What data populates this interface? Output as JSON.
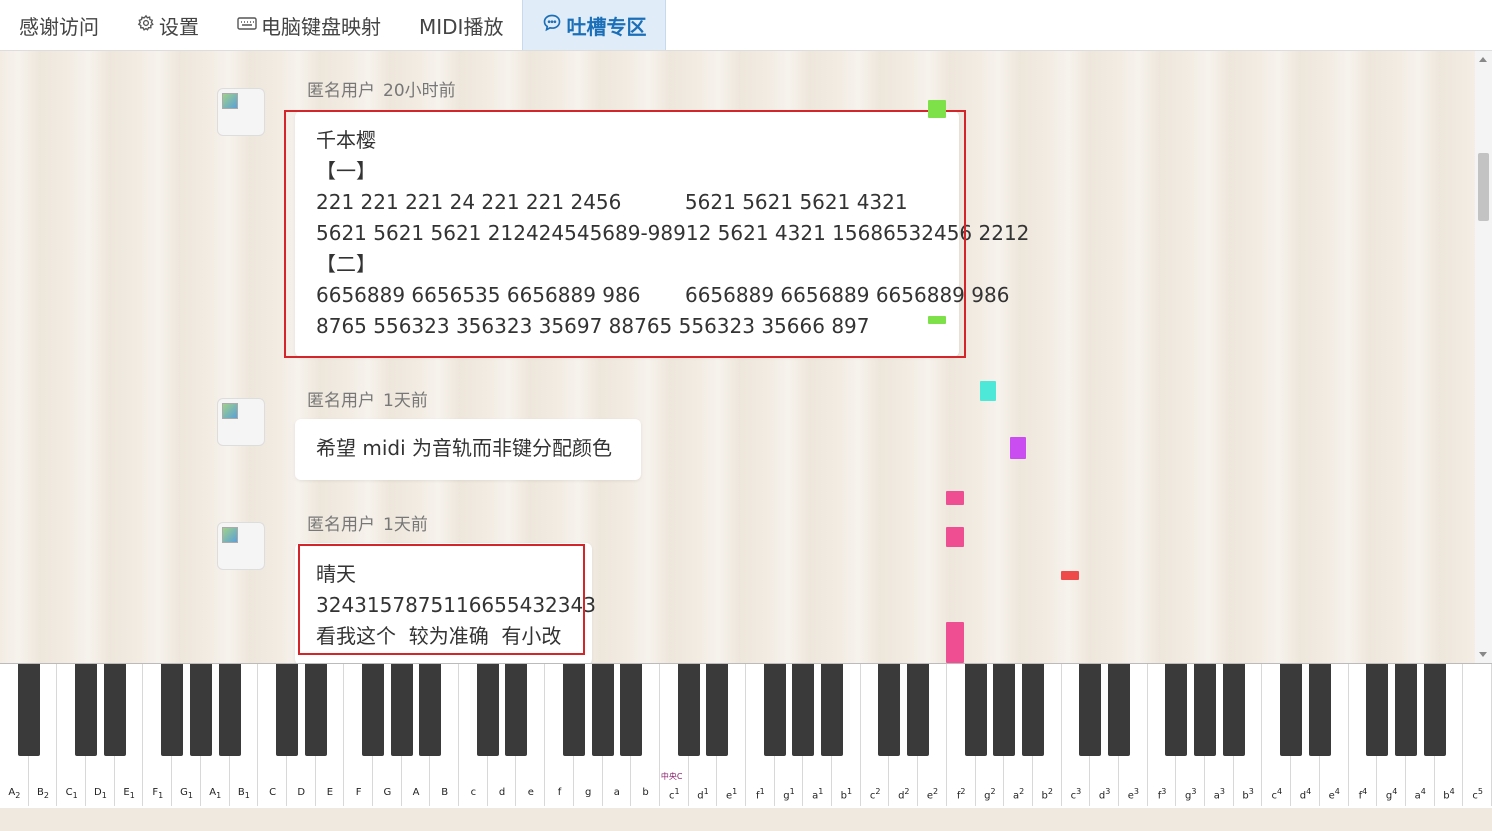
{
  "nav": {
    "tabs": [
      {
        "label": "感谢访问",
        "icon": "",
        "active": false
      },
      {
        "label": "设置",
        "icon": "gear-icon",
        "active": false
      },
      {
        "label": "电脑键盘映射",
        "icon": "keyboard-icon",
        "active": false
      },
      {
        "label": "MIDI播放",
        "icon": "",
        "active": false
      },
      {
        "label": "吐槽专区",
        "icon": "chat-icon",
        "active": true
      }
    ]
  },
  "comments": [
    {
      "user": "匿名用户",
      "time": "20小时前",
      "lines": [
        "千本樱",
        "【一】",
        "221 221 221 24 221 221 2456          5621 5621 5621 4321",
        "5621 5621 5621 212424545689-98912 5621 4321 15686532456 2212",
        "【二】",
        "6656889 6656535 6656889 986       6656889 6656889 6656889 986",
        "8765 556323 356323 35697 88765 556323 35666 897"
      ]
    },
    {
      "user": "匿名用户",
      "time": "1天前",
      "lines": [
        "希望 midi 为音轨而非键分配颜色"
      ]
    },
    {
      "user": "匿名用户",
      "time": "1天前",
      "lines": [
        "晴天",
        "32431578751166554323​43",
        "看我这个  较为准确  有小改"
      ]
    }
  ],
  "colors": {
    "highlight": "#d3262a",
    "active_tab": "#1b6fb8",
    "note_green": "#7fe14a",
    "note_cyan": "#4de8d8",
    "note_purple": "#c94df0",
    "note_pink": "#ef4e93",
    "note_red": "#ee4a4a"
  },
  "piano": {
    "middle_c_label": "中央C",
    "white_keys": [
      {
        "n": "A",
        "s": "2"
      },
      {
        "n": "B",
        "s": "2"
      },
      {
        "n": "C",
        "s": "1"
      },
      {
        "n": "D",
        "s": "1"
      },
      {
        "n": "E",
        "s": "1"
      },
      {
        "n": "F",
        "s": "1"
      },
      {
        "n": "G",
        "s": "1"
      },
      {
        "n": "A",
        "s": "1"
      },
      {
        "n": "B",
        "s": "1"
      },
      {
        "n": "C",
        "s": ""
      },
      {
        "n": "D",
        "s": ""
      },
      {
        "n": "E",
        "s": ""
      },
      {
        "n": "F",
        "s": ""
      },
      {
        "n": "G",
        "s": ""
      },
      {
        "n": "A",
        "s": ""
      },
      {
        "n": "B",
        "s": ""
      },
      {
        "n": "c",
        "s": ""
      },
      {
        "n": "d",
        "s": ""
      },
      {
        "n": "e",
        "s": ""
      },
      {
        "n": "f",
        "s": ""
      },
      {
        "n": "g",
        "s": ""
      },
      {
        "n": "a",
        "s": ""
      },
      {
        "n": "b",
        "s": ""
      },
      {
        "n": "c",
        "p": "1"
      },
      {
        "n": "d",
        "p": "1"
      },
      {
        "n": "e",
        "p": "1"
      },
      {
        "n": "f",
        "p": "1"
      },
      {
        "n": "g",
        "p": "1"
      },
      {
        "n": "a",
        "p": "1"
      },
      {
        "n": "b",
        "p": "1"
      },
      {
        "n": "c",
        "p": "2"
      },
      {
        "n": "d",
        "p": "2"
      },
      {
        "n": "e",
        "p": "2"
      },
      {
        "n": "f",
        "p": "2"
      },
      {
        "n": "g",
        "p": "2"
      },
      {
        "n": "a",
        "p": "2"
      },
      {
        "n": "b",
        "p": "2"
      },
      {
        "n": "c",
        "p": "3"
      },
      {
        "n": "d",
        "p": "3"
      },
      {
        "n": "e",
        "p": "3"
      },
      {
        "n": "f",
        "p": "3"
      },
      {
        "n": "g",
        "p": "3"
      },
      {
        "n": "a",
        "p": "3"
      },
      {
        "n": "b",
        "p": "3"
      },
      {
        "n": "c",
        "p": "4"
      },
      {
        "n": "d",
        "p": "4"
      },
      {
        "n": "e",
        "p": "4"
      },
      {
        "n": "f",
        "p": "4"
      },
      {
        "n": "g",
        "p": "4"
      },
      {
        "n": "a",
        "p": "4"
      },
      {
        "n": "b",
        "p": "4"
      },
      {
        "n": "c",
        "p": "5"
      }
    ]
  }
}
